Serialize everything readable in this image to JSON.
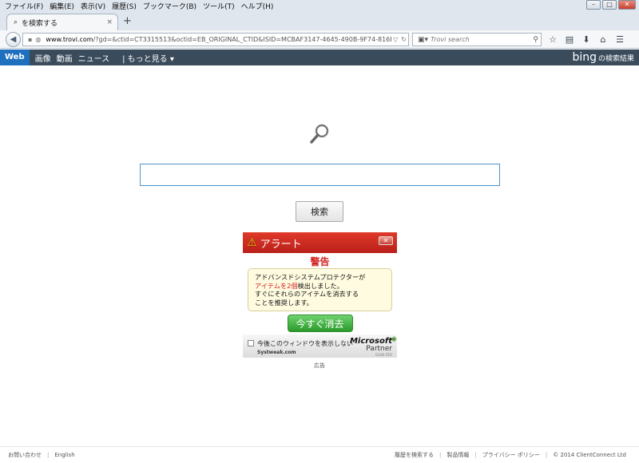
{
  "menu": [
    "ファイル(F)",
    "編集(E)",
    "表示(V)",
    "履歴(S)",
    "ブックマーク(B)",
    "ツール(T)",
    "ヘルプ(H)"
  ],
  "tab": {
    "title": "を検索する",
    "close": "×",
    "new_tab": "+"
  },
  "url": {
    "domain": "www.trovi.com",
    "path": "/?gd=&ctid=CT3315513&octid=EB_ORIGINAL_CTID&ISID=MCBAF3147-4645-490B-9F74-816B"
  },
  "search": {
    "placeholder": "Trovi search"
  },
  "bing_nav": {
    "items": [
      "Web",
      "画像",
      "動画",
      "ニュース"
    ],
    "more": "| もっと見る ▾",
    "logo": "bing",
    "logo_suffix": "の検索結果"
  },
  "main": {
    "search_button": "検索",
    "search_value": ""
  },
  "alert": {
    "title": "アラート",
    "warning": "警告",
    "line1": "アドバンスドシステムプロテクターが",
    "line2_red": "アイテムを2個",
    "line2_rest": "検出しました。",
    "line3": "すぐにそれらのアイテムを消去する",
    "line4": "ことを推奨します。",
    "button": "今すぐ消去",
    "dont_show": "今後このウィンドウを表示しない",
    "systweak": "Systweak.com",
    "ms_brand": "Microsoft",
    "ms_partner": "Partner",
    "ms_level": "Gold ISV",
    "ad_label": "広告"
  },
  "footer": {
    "left": [
      "お問い合わせ",
      "English"
    ],
    "right": [
      "履歴を検索する",
      "製品情報",
      "プライバシー ポリシー",
      "© 2014 ClientConnect Ltd"
    ]
  },
  "colors": {
    "bing_bar": "#3a4b5c",
    "web_tab": "#1f6fbf",
    "alert_red": "#d21f1f",
    "clean_green": "#2a9a2a"
  }
}
